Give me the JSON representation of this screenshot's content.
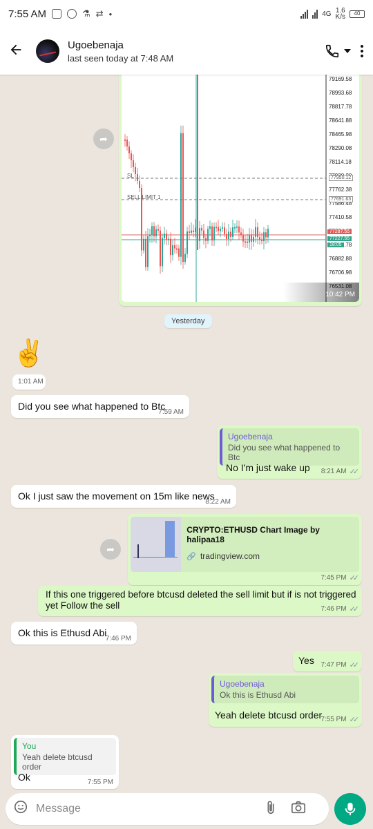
{
  "status_bar": {
    "time": "7:55 AM",
    "network": "4G",
    "speed_value": "1.6",
    "speed_unit": "K/s",
    "battery": "40"
  },
  "header": {
    "name": "Ugoebenaja",
    "last_seen": "last seen today at 7:48 AM"
  },
  "chart_image": {
    "price_labels": [
      "79169.58",
      "78993.68",
      "78817.78",
      "78641.88",
      "78465.98",
      "78290.08",
      "78114.18",
      "77938.28",
      "77762.38",
      "77586.48",
      "77410.58",
      "77234.68",
      "77058.78",
      "76882.88",
      "76706.98",
      "76531.08"
    ],
    "sl_label": "SL",
    "sell_limit_label": "SELL LIMIT 1",
    "tag_top": "77950.12",
    "tag_mid": "77691.63",
    "tag_red": "77287.55",
    "tag_green": "77227.55",
    "tag_time": "18:05",
    "timestamp": "10:42 PM"
  },
  "date_separator": "Yesterday",
  "messages": {
    "m1": {
      "text": "✌️",
      "time": "1:01 AM"
    },
    "m2": {
      "text": "Did you see what happened to Btc",
      "time": "7:59 AM"
    },
    "m3": {
      "quote_name": "Ugoebenaja",
      "quote_text": "Did you see what happened to Btc",
      "text": "No I'm just wake up",
      "time": "8:21 AM"
    },
    "m4": {
      "text": "Ok I just saw the movement on 15m like news",
      "time": "8:22 AM"
    },
    "m5": {
      "link_title": "CRYPTO:ETHUSD Chart Image by halipaa18",
      "link_domain": "tradingview.com",
      "time": "7:45 PM"
    },
    "m6": {
      "text": "If this one triggered before btcusd deleted the sell limit but if is not triggered yet Follow the sell",
      "time": "7:46 PM"
    },
    "m7": {
      "text": "Ok this is Ethusd Abi",
      "time": "7:46 PM"
    },
    "m8": {
      "text": "Yes",
      "time": "7:47 PM"
    },
    "m9": {
      "quote_name": "Ugoebenaja",
      "quote_text": "Ok this is Ethusd Abi",
      "text": "Yeah delete btcusd order",
      "time": "7:55 PM"
    },
    "m10": {
      "quote_name": "You",
      "quote_text": "Yeah delete btcusd order",
      "text": "Ok",
      "time": "7:55 PM"
    }
  },
  "composer": {
    "placeholder": "Message"
  },
  "colors": {
    "outgoing": "#dcf8c6",
    "incoming": "#ffffff",
    "accent": "#00a884",
    "read_ticks": "#4fc3f7"
  }
}
